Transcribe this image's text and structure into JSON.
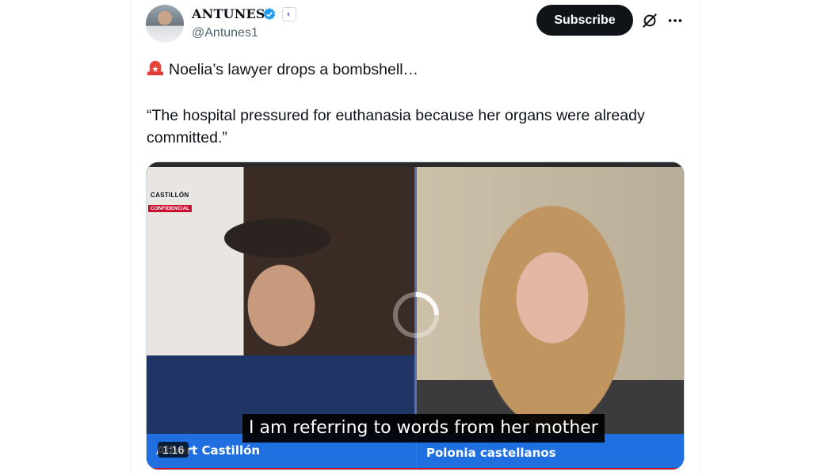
{
  "author": {
    "display_name": "ANTUNES",
    "handle": "@Antunes1"
  },
  "actions": {
    "subscribe_label": "Subscribe"
  },
  "icons": {
    "verified": "verified-badge-icon",
    "affiliation": "affiliation-badge-icon",
    "grok": "grok-icon",
    "more": "more-icon",
    "siren": "siren-emoji-icon"
  },
  "tweet": {
    "line1": "Noelia’s lawyer drops a bombshell…",
    "line2": "“The hospital pressured for euthanasia because her organs were already committed.”"
  },
  "media": {
    "station_name": "CASTILLÓN",
    "station_tag": "CONFIDENCIAL",
    "left_name": "Albert Castillón",
    "right_name": "Polonia castellanos",
    "subtitle": "I am referring to words from her mother",
    "duration": "1:16"
  },
  "colors": {
    "verified": "#1d9bf0",
    "subscribe_bg": "#0f1419",
    "lower_third": "#1f6fe0"
  }
}
